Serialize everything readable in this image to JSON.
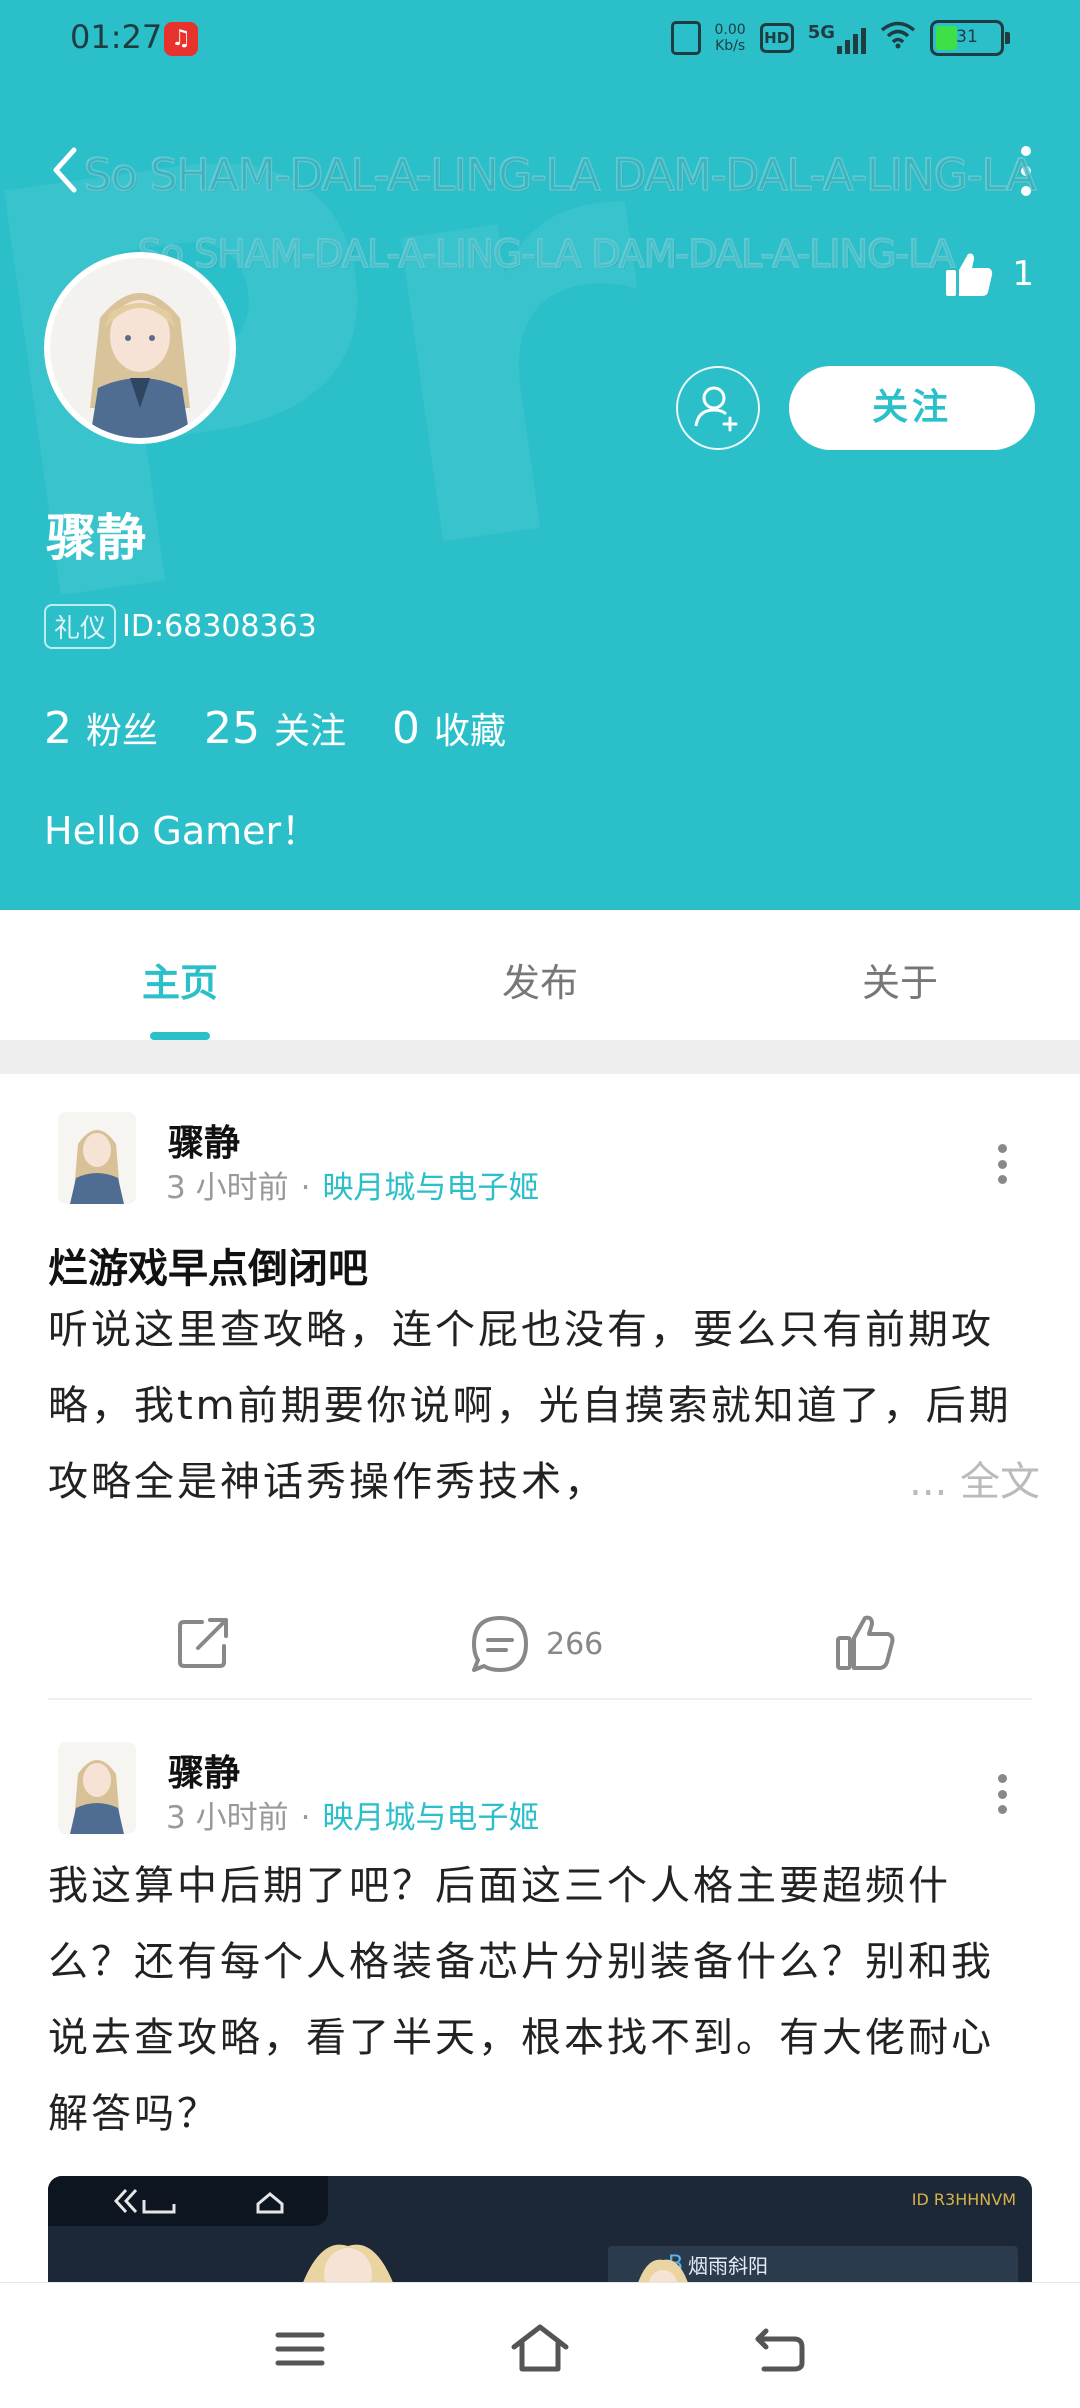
{
  "status_bar": {
    "time": "01:27",
    "net_speed": "0.00\nKb/s",
    "hd": "HD",
    "signal": "5G",
    "battery": "31"
  },
  "header": {
    "marquee_line_1": "So SHAM-DAL-A-LING-LA DAM-DAL-A-LING-LA",
    "marquee_line_2": "So SHAM-DAL-A-LING-LA DAM-DAL-A-LING-LA",
    "like_count": "1",
    "follow_label": "关注",
    "username": "骤静",
    "id_badge": "礼仪",
    "id_text": "ID:68308363",
    "stats": [
      {
        "num": "2",
        "label": "粉丝"
      },
      {
        "num": "25",
        "label": "关注"
      },
      {
        "num": "0",
        "label": "收藏"
      }
    ],
    "bio": "Hello Gamer！",
    "accent_color": "#2bbfca"
  },
  "tabs": [
    {
      "label": "主页",
      "active": true
    },
    {
      "label": "发布",
      "active": false
    },
    {
      "label": "关于",
      "active": false
    }
  ],
  "posts": [
    {
      "author": "骤静",
      "time": "3 小时前",
      "separator": "·",
      "forum": "映月城与电子姬",
      "title": "烂游戏早点倒闭吧",
      "body": "听说这里查攻略，连个屁也没有，要么只有前期攻略，我tm前期要你说啊，光自摸索就知道了，后期攻略全是神话秀操作秀技术，",
      "more": "... 全文",
      "comment_count": "266"
    },
    {
      "author": "骤静",
      "time": "3 小时前",
      "separator": "·",
      "forum": "映月城与电子姬",
      "body": "我这算中后期了吧？后面这三个人格主要超频什么？还有每个人格装备芯片分别装备什么？别和我说去查攻略，看了半天，根本找不到。有大佬耐心解答吗？",
      "image": {
        "id_label": "ID R3HHNVM",
        "name_label": "烟雨斜阳",
        "badge": "B"
      }
    }
  ]
}
